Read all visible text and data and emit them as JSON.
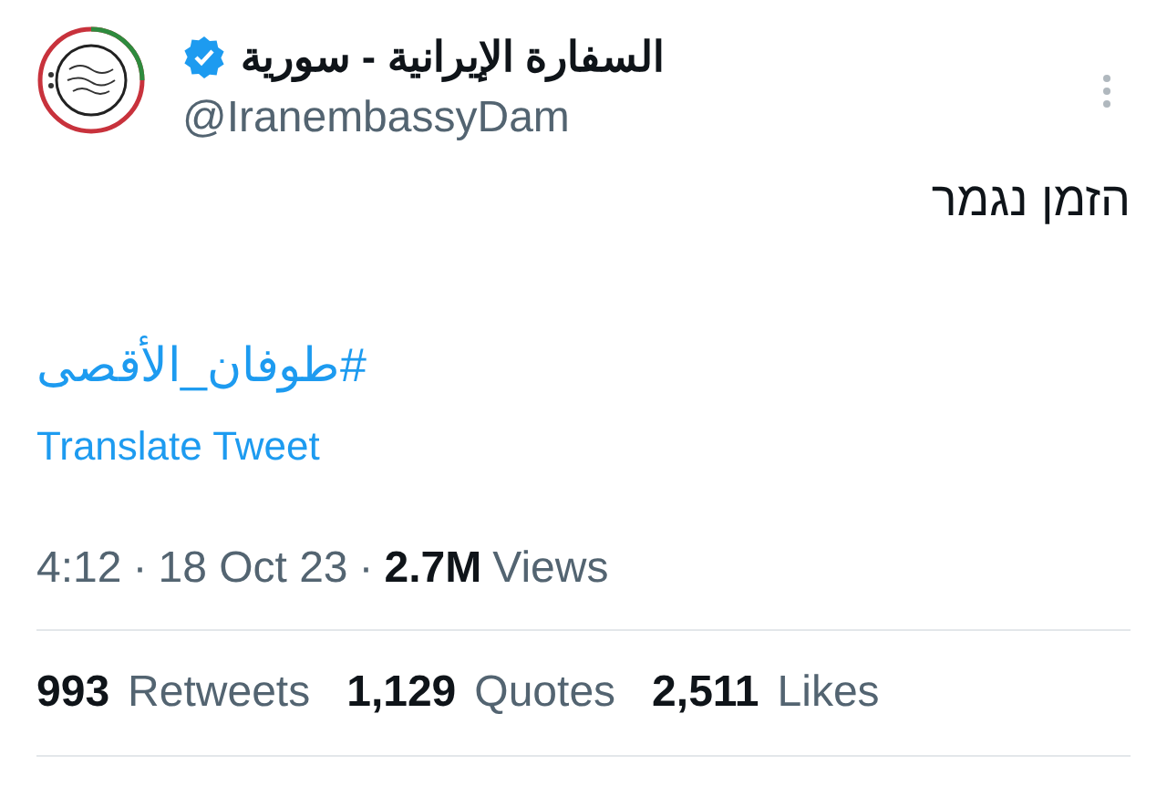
{
  "author": {
    "name": "السفارة الإيرانية - سورية",
    "verified": true,
    "handle": "@IranembassyDam"
  },
  "text": "הזמן נגמר",
  "hashtag": "#طوفان_الأقصى",
  "translate_link": "Translate Tweet",
  "meta": {
    "time": "4:12",
    "separator_1": "·",
    "date": "18 Oct 23",
    "separator_2": "·",
    "views_count": "2.7M",
    "views_label": "Views"
  },
  "stats": [
    {
      "count": "993",
      "label": "Retweets"
    },
    {
      "count": "1,129",
      "label": "Quotes"
    },
    {
      "count": "2,511",
      "label": "Likes"
    }
  ]
}
